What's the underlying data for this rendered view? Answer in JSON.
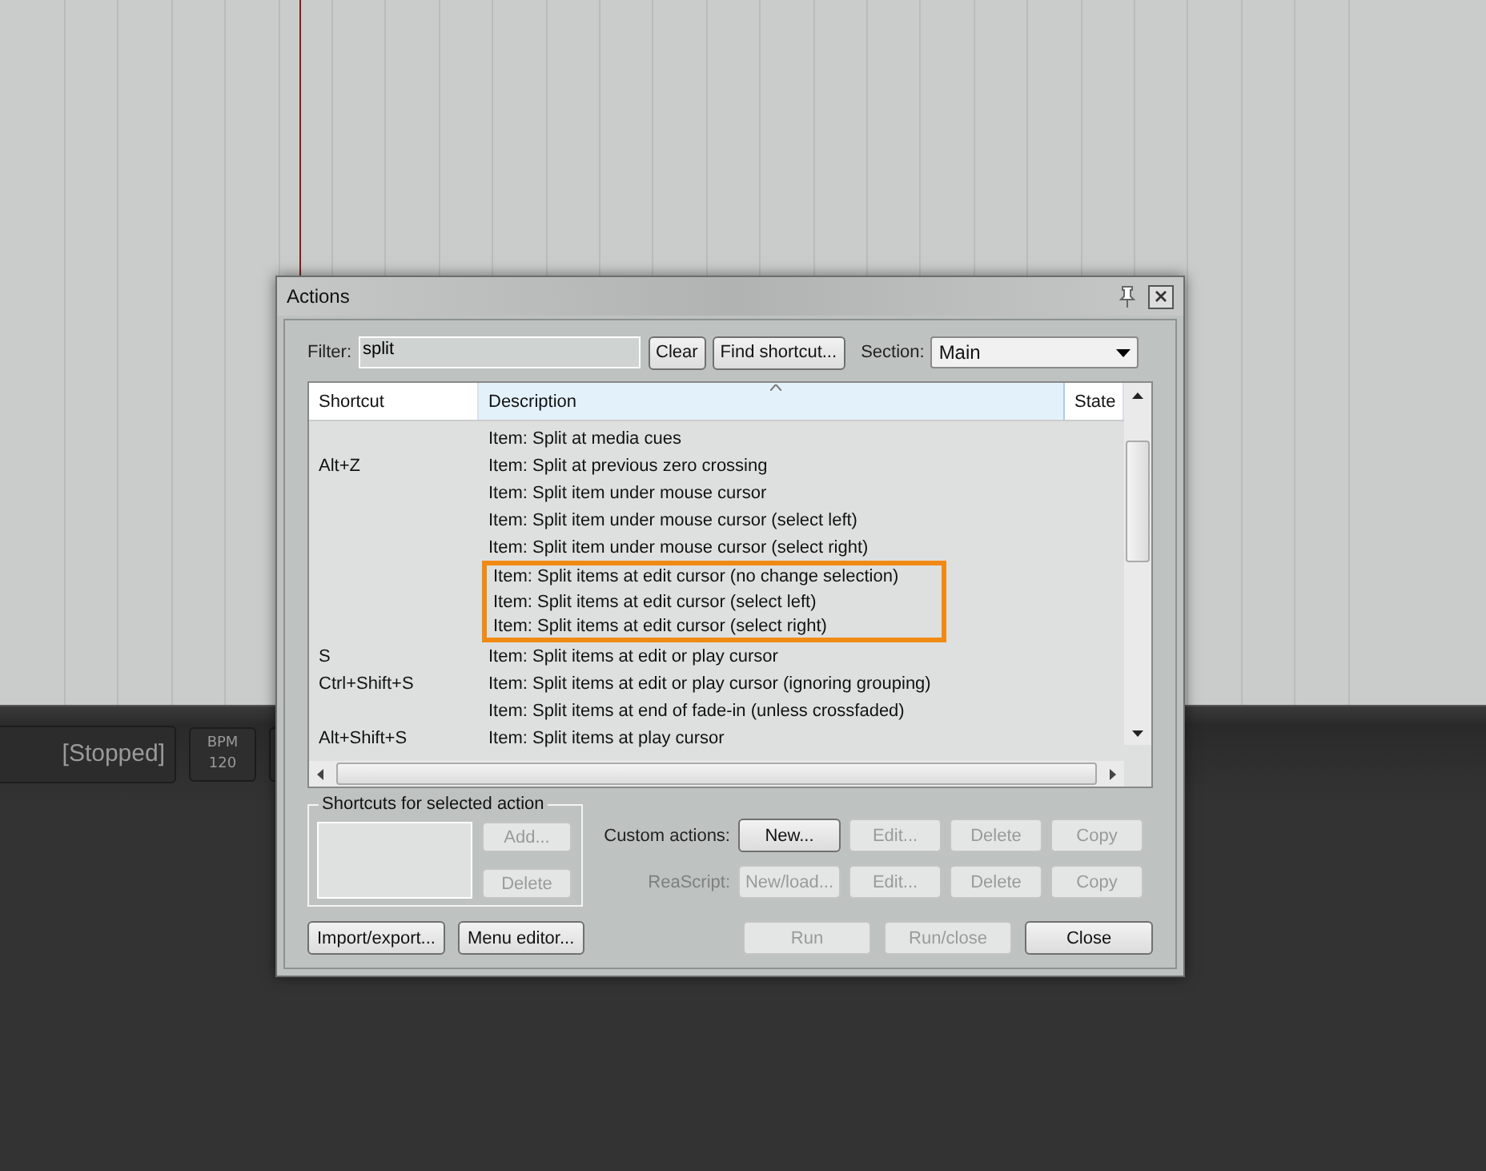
{
  "transport": {
    "status": "[Stopped]",
    "bpm_label": "BPM",
    "bpm": "120"
  },
  "dialog": {
    "title": "Actions",
    "filter": {
      "label": "Filter:",
      "value": "split"
    },
    "clear_button": "Clear",
    "find_button": "Find shortcut...",
    "section": {
      "label": "Section:",
      "value": "Main"
    },
    "table": {
      "columns": [
        "Shortcut",
        "Description",
        "State"
      ],
      "rows": [
        {
          "shortcut": "",
          "description": "Item: Split at media cues",
          "highlighted": false
        },
        {
          "shortcut": "Alt+Z",
          "description": "Item: Split at previous zero crossing",
          "highlighted": false
        },
        {
          "shortcut": "",
          "description": "Item: Split item under mouse cursor",
          "highlighted": false
        },
        {
          "shortcut": "",
          "description": "Item: Split item under mouse cursor (select left)",
          "highlighted": false
        },
        {
          "shortcut": "",
          "description": "Item: Split item under mouse cursor (select right)",
          "highlighted": false
        },
        {
          "shortcut": "",
          "description": "Item: Split items at edit cursor (no change selection)",
          "highlighted": true
        },
        {
          "shortcut": "",
          "description": "Item: Split items at edit cursor (select left)",
          "highlighted": true
        },
        {
          "shortcut": "",
          "description": "Item: Split items at edit cursor (select right)",
          "highlighted": true
        },
        {
          "shortcut": "S",
          "description": "Item: Split items at edit or play cursor",
          "highlighted": false
        },
        {
          "shortcut": "Ctrl+Shift+S",
          "description": "Item: Split items at edit or play cursor (ignoring grouping)",
          "highlighted": false
        },
        {
          "shortcut": "",
          "description": "Item: Split items at end of fade-in (unless crossfaded)",
          "highlighted": false
        },
        {
          "shortcut": "Alt+Shift+S",
          "description": "Item: Split items at play cursor",
          "highlighted": false
        }
      ]
    },
    "shortcuts_group": {
      "title": "Shortcuts for selected action",
      "buttons": [
        {
          "label": "Add...",
          "disabled": true
        },
        {
          "label": "Delete",
          "disabled": true
        }
      ]
    },
    "action_rows": [
      {
        "label": "Custom actions:",
        "disabled": false,
        "buttons": [
          {
            "label": "New...",
            "disabled": false
          },
          {
            "label": "Edit...",
            "disabled": true
          },
          {
            "label": "Delete",
            "disabled": true
          },
          {
            "label": "Copy",
            "disabled": true
          }
        ]
      },
      {
        "label": "ReaScript:",
        "disabled": true,
        "buttons": [
          {
            "label": "New/load...",
            "disabled": true
          },
          {
            "label": "Edit...",
            "disabled": true
          },
          {
            "label": "Delete",
            "disabled": true
          },
          {
            "label": "Copy",
            "disabled": true
          }
        ]
      }
    ],
    "bottom_left_buttons": [
      {
        "label": "Import/export...",
        "disabled": false
      },
      {
        "label": "Menu editor...",
        "disabled": false
      }
    ],
    "bottom_right_buttons": [
      {
        "label": "Run",
        "disabled": true
      },
      {
        "label": "Run/close",
        "disabled": true
      },
      {
        "label": "Close",
        "disabled": false
      }
    ]
  }
}
